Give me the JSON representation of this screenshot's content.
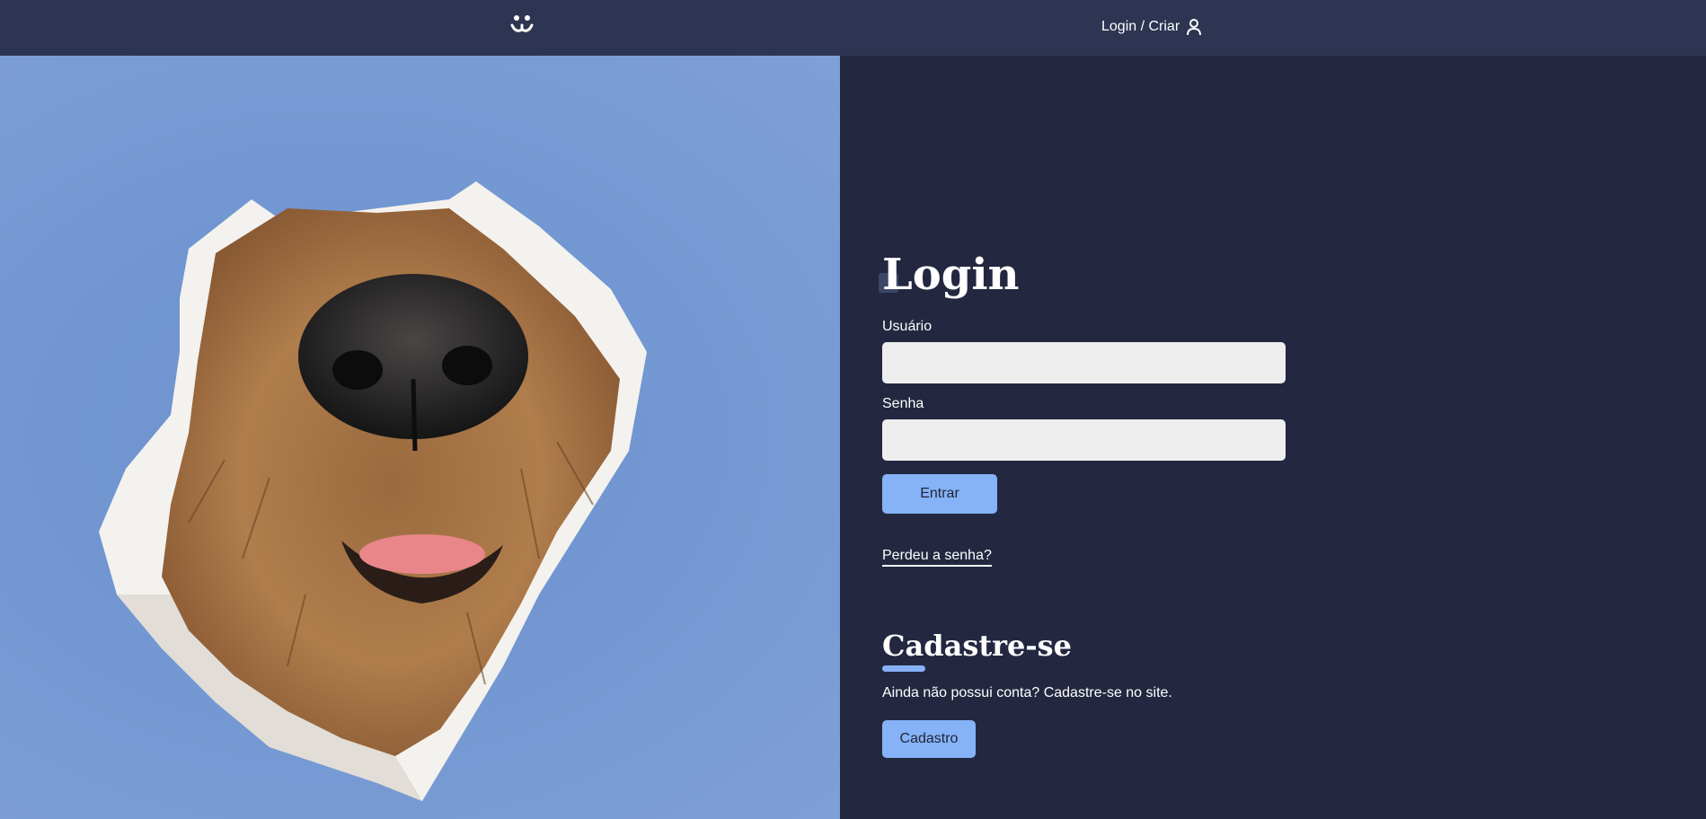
{
  "header": {
    "logo_icon": "dog-face-icon",
    "login_link_label": "Login / Criar",
    "user_icon": "user-icon"
  },
  "photo": {
    "description_icon": "dog-photo"
  },
  "login": {
    "title": "Login",
    "username_label": "Usuário",
    "username_value": "",
    "password_label": "Senha",
    "password_value": "",
    "submit_label": "Entrar",
    "lost_password_label": "Perdeu a senha?"
  },
  "register": {
    "title": "Cadastre-se",
    "text": "Ainda não possui conta? Cadastre-se no site.",
    "button_label": "Cadastro"
  },
  "colors": {
    "header_bg": "#2d3552",
    "page_bg": "#232840",
    "accent": "#86b2f7",
    "input_bg": "#eeeeee",
    "photo_bg": "#7196d1"
  }
}
